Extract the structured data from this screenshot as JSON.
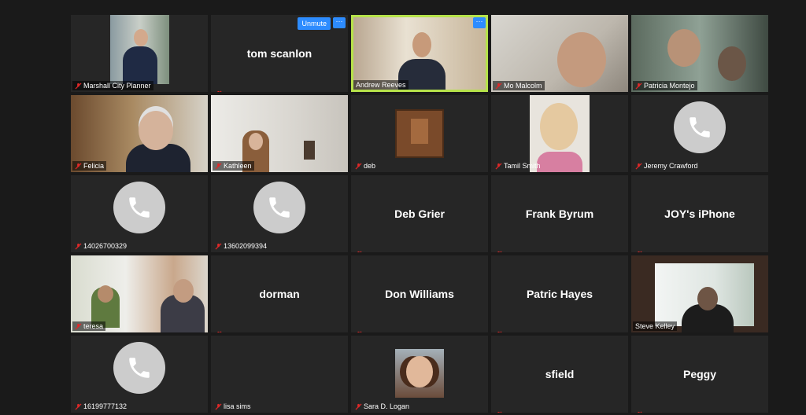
{
  "participants": [
    {
      "name": "Marshall City Planner",
      "kind": "video"
    },
    {
      "name": "tom scanlon",
      "kind": "name",
      "unmute": "Unmute"
    },
    {
      "name": "Andrew Reeves",
      "kind": "video",
      "active": true
    },
    {
      "name": "Mo Malcolm",
      "kind": "video"
    },
    {
      "name": "Patricia Montejo",
      "kind": "video"
    },
    {
      "name": "Felicia",
      "kind": "video"
    },
    {
      "name": "Kathleen",
      "kind": "video"
    },
    {
      "name": "deb",
      "kind": "avatar"
    },
    {
      "name": "Tamil Smith",
      "kind": "avatar"
    },
    {
      "name": "Jeremy Crawford",
      "kind": "phone"
    },
    {
      "name": "14026700329",
      "kind": "phone"
    },
    {
      "name": "13602099394",
      "kind": "phone"
    },
    {
      "name": "Deb Grier",
      "kind": "name"
    },
    {
      "name": "Frank Byrum",
      "kind": "name"
    },
    {
      "name": "JOY's iPhone",
      "kind": "name"
    },
    {
      "name": "teresa",
      "kind": "video"
    },
    {
      "name": "dorman",
      "kind": "name"
    },
    {
      "name": "Don Williams",
      "kind": "name"
    },
    {
      "name": "Patric Hayes",
      "kind": "name"
    },
    {
      "name": "Steve Kelley",
      "kind": "video"
    },
    {
      "name": "16199777132",
      "kind": "phone"
    },
    {
      "name": "lisa sims",
      "kind": "name",
      "hideCenter": true
    },
    {
      "name": "Sara D. Logan",
      "kind": "avatar"
    },
    {
      "name": "sfield",
      "kind": "name"
    },
    {
      "name": "Peggy",
      "kind": "name"
    }
  ],
  "more_label": "···",
  "colors": {
    "active_border": "#b6e24a",
    "button": "#2d8cff",
    "tile": "#262626"
  }
}
